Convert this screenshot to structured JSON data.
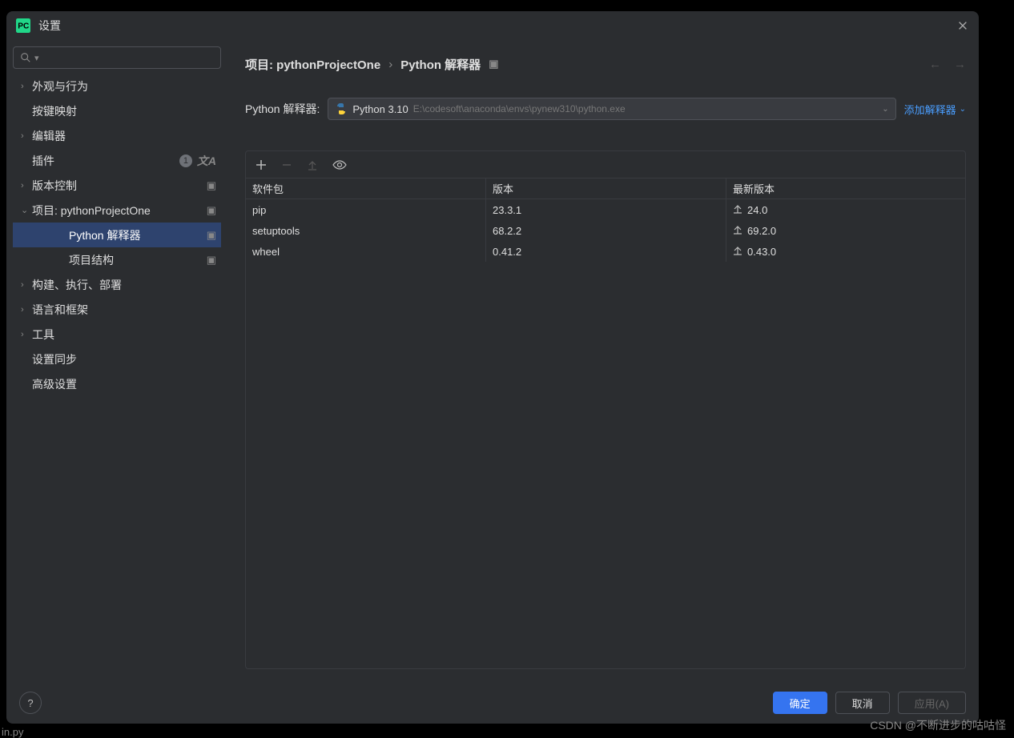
{
  "title": "设置",
  "sidebar": {
    "items": [
      {
        "label": "外观与行为",
        "chev": "›"
      },
      {
        "label": "按键映射"
      },
      {
        "label": "编辑器",
        "chev": "›"
      },
      {
        "label": "插件",
        "badge": "1",
        "lang": true
      },
      {
        "label": "版本控制",
        "chev": "›",
        "cube": true
      },
      {
        "label": "项目: pythonProjectOne",
        "chev": "⌄",
        "cube": true
      },
      {
        "label": "Python 解释器",
        "cube": true,
        "indent": 2,
        "selected": true
      },
      {
        "label": "项目结构",
        "cube": true,
        "indent": 2
      },
      {
        "label": "构建、执行、部署",
        "chev": "›"
      },
      {
        "label": "语言和框架",
        "chev": "›"
      },
      {
        "label": "工具",
        "chev": "›"
      },
      {
        "label": "设置同步"
      },
      {
        "label": "高级设置"
      }
    ]
  },
  "breadcrumb": {
    "part1": "项目: pythonProjectOne",
    "sep": "›",
    "part2": "Python 解释器"
  },
  "interpreter": {
    "label": "Python 解释器:",
    "name": "Python 3.10",
    "path": "E:\\codesoft\\anaconda\\envs\\pynew310\\python.exe",
    "add_label": "添加解释器"
  },
  "packages": {
    "headers": {
      "name": "软件包",
      "version": "版本",
      "latest": "最新版本"
    },
    "rows": [
      {
        "name": "pip",
        "version": "23.3.1",
        "latest": "24.0",
        "up": true
      },
      {
        "name": "setuptools",
        "version": "68.2.2",
        "latest": "69.2.0",
        "up": true
      },
      {
        "name": "wheel",
        "version": "0.41.2",
        "latest": "0.43.0",
        "up": true
      }
    ]
  },
  "buttons": {
    "ok": "确定",
    "cancel": "取消",
    "apply": "应用(A)"
  },
  "watermark": "CSDN @不断进步的咕咕怪",
  "status": "in.py"
}
